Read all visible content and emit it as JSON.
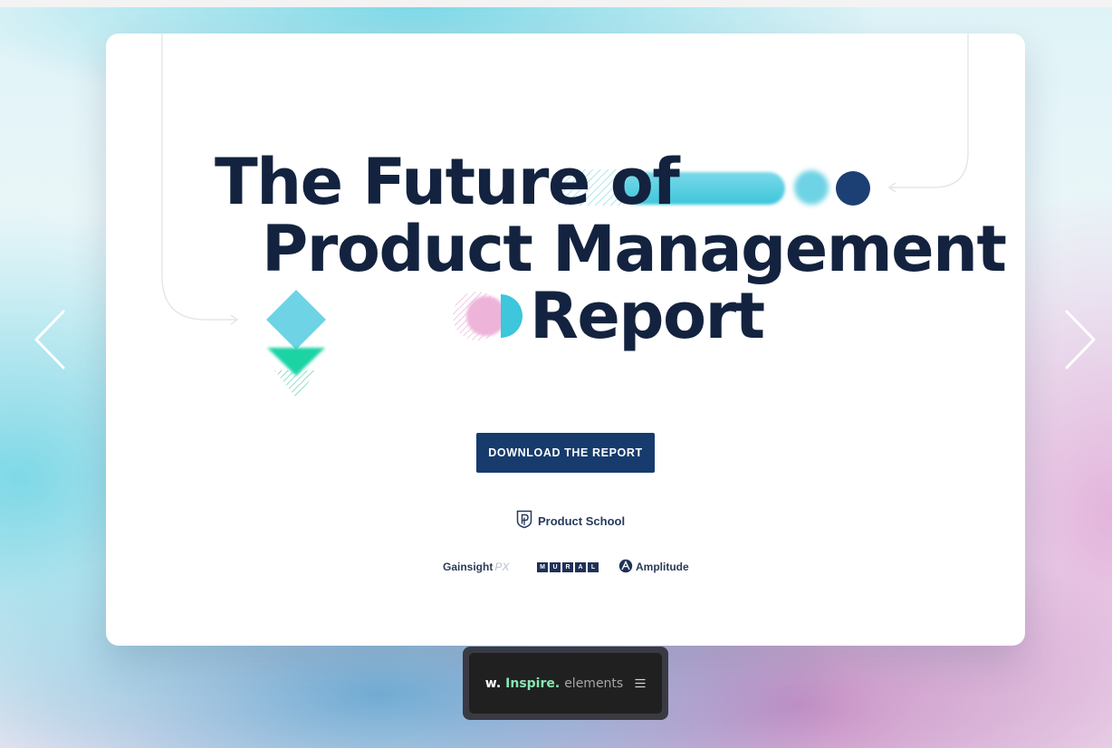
{
  "hero": {
    "title_line1": "The Future of",
    "title_line2": "Product Management",
    "title_line3": "Report",
    "cta_label": "DOWNLOAD THE REPORT"
  },
  "brand": {
    "name": "Product School"
  },
  "partners": {
    "gainsight": "Gainsight",
    "gainsight_px": "PX",
    "mural_letters": [
      "M",
      "U",
      "R",
      "A",
      "L"
    ],
    "amplitude": "Amplitude"
  },
  "toolbar": {
    "logo_w": "w.",
    "logo_inspire": "Inspire.",
    "logo_elements": "elements"
  },
  "colors": {
    "navy": "#13233f",
    "button": "#163b6c",
    "cyan": "#45c8dc",
    "green": "#1fd3a4",
    "pink": "#eab0d8",
    "toolbar_accent": "#86e6b2"
  },
  "icons": {
    "prev": "chevron-left-icon",
    "next": "chevron-right-icon",
    "menu": "hamburger-menu-icon",
    "brand": "product-school-shield-icon",
    "amplitude": "amplitude-a-icon"
  }
}
